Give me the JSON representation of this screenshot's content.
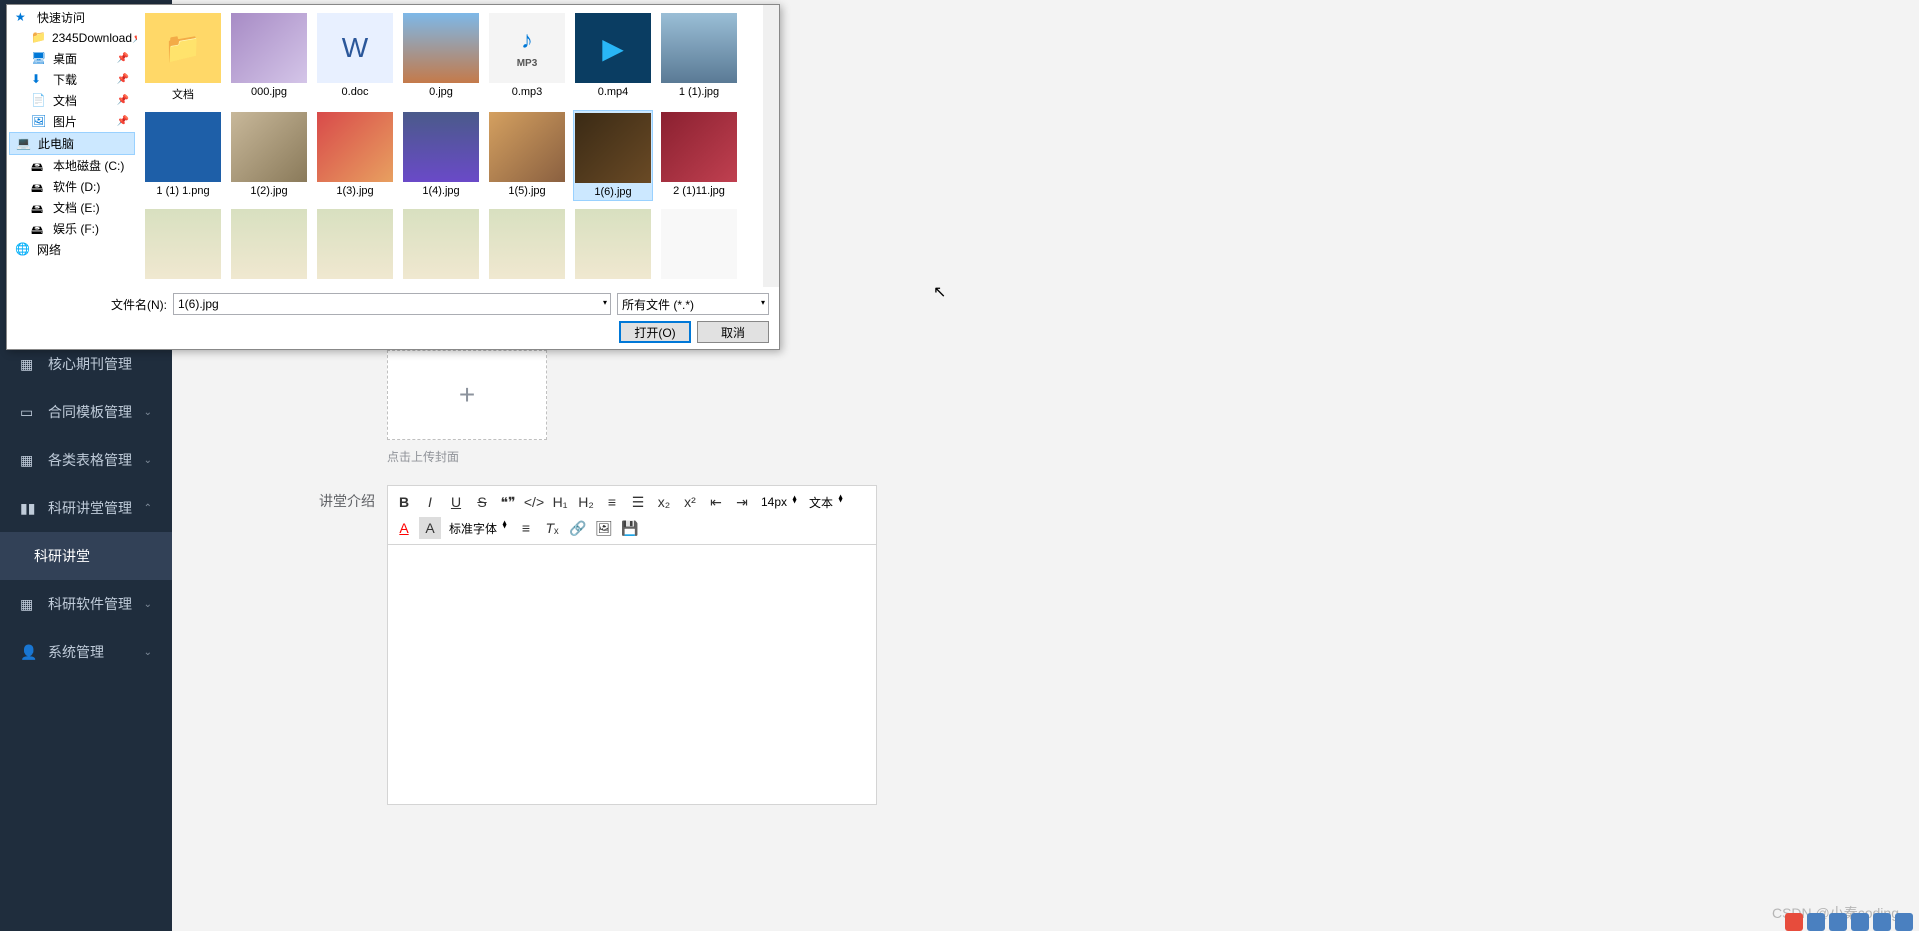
{
  "sidebar": {
    "items": [
      {
        "label": "核心期刊管理"
      },
      {
        "label": "合同模板管理"
      },
      {
        "label": "各类表格管理"
      },
      {
        "label": "科研讲堂管理"
      },
      {
        "label": "科研讲堂"
      },
      {
        "label": "科研软件管理"
      },
      {
        "label": "系统管理"
      }
    ]
  },
  "form": {
    "upload_hint": "点击上传封面",
    "intro_label": "讲堂介绍"
  },
  "editor": {
    "font_size": "14px",
    "text_mode": "文本",
    "font_family": "标准字体"
  },
  "file_dialog": {
    "nav": {
      "quick_access": "快速访问",
      "download_folder": "2345Download",
      "desktop": "桌面",
      "downloads": "下载",
      "documents": "文档",
      "pictures": "图片",
      "this_pc": "此电脑",
      "local_c": "本地磁盘 (C:)",
      "software_d": "软件 (D:)",
      "docs_e": "文档 (E:)",
      "ent_f": "娱乐 (F:)",
      "network": "网络"
    },
    "files": [
      {
        "name": "文档",
        "type": "folder"
      },
      {
        "name": "000.jpg",
        "type": "img",
        "cls": "tp-lotus"
      },
      {
        "name": "0.doc",
        "type": "doc"
      },
      {
        "name": "0.jpg",
        "type": "img",
        "cls": "tp-ferris"
      },
      {
        "name": "0.mp3",
        "type": "mp3"
      },
      {
        "name": "0.mp4",
        "type": "mp4"
      },
      {
        "name": "1 (1).jpg",
        "type": "img",
        "cls": "tp-city"
      },
      {
        "name": "1 (1) 1.png",
        "type": "img",
        "cls": "tp-blue"
      },
      {
        "name": "1(2).jpg",
        "type": "img",
        "cls": "tp-food"
      },
      {
        "name": "1(3).jpg",
        "type": "img",
        "cls": "tp-anime"
      },
      {
        "name": "1(4).jpg",
        "type": "img",
        "cls": "tp-phone"
      },
      {
        "name": "1(5).jpg",
        "type": "img",
        "cls": "tp-dog"
      },
      {
        "name": "1(6).jpg",
        "type": "img",
        "cls": "tp-book",
        "selected": true
      },
      {
        "name": "2 (1)11.jpg",
        "type": "img",
        "cls": "tp-red"
      },
      {
        "name": "",
        "type": "img",
        "cls": "tp-person"
      },
      {
        "name": "",
        "type": "img",
        "cls": "tp-person"
      },
      {
        "name": "",
        "type": "img",
        "cls": "tp-person"
      },
      {
        "name": "",
        "type": "img",
        "cls": "tp-person"
      },
      {
        "name": "",
        "type": "img",
        "cls": "tp-person"
      },
      {
        "name": "",
        "type": "img",
        "cls": "tp-person"
      },
      {
        "name": "",
        "type": "img",
        "cls": "tp-white"
      }
    ],
    "filename_label": "文件名(N):",
    "filename_value": "1(6).jpg",
    "filter": "所有文件 (*.*)",
    "open_btn": "打开(O)",
    "cancel_btn": "取消"
  },
  "watermark": "CSDN @小秦coding"
}
